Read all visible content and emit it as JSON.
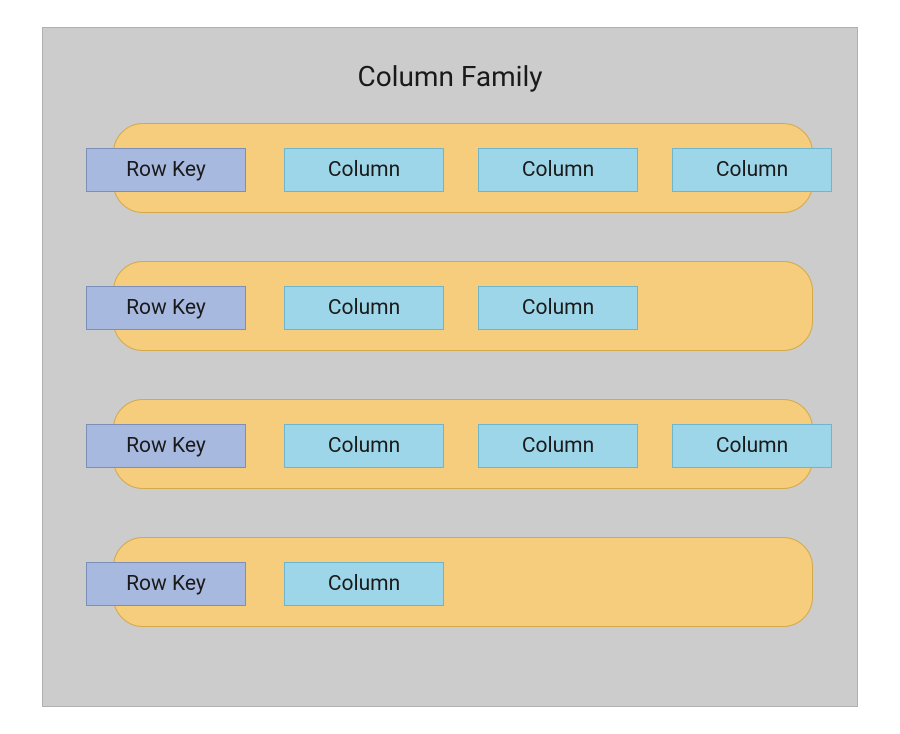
{
  "title": "Column Family",
  "rowKeyLabel": "Row Key",
  "columnLabel": "Column",
  "rows": [
    {
      "columns": 3
    },
    {
      "columns": 2
    },
    {
      "columns": 3
    },
    {
      "columns": 1
    }
  ],
  "colors": {
    "background": "#cccccc",
    "pill": "#f6cd7c",
    "pillBorder": "#d4a94a",
    "rowKey": "#a8b9e0",
    "rowKeyBorder": "#7b8fb8",
    "column": "#9dd6e8",
    "columnBorder": "#6fb5cc"
  }
}
